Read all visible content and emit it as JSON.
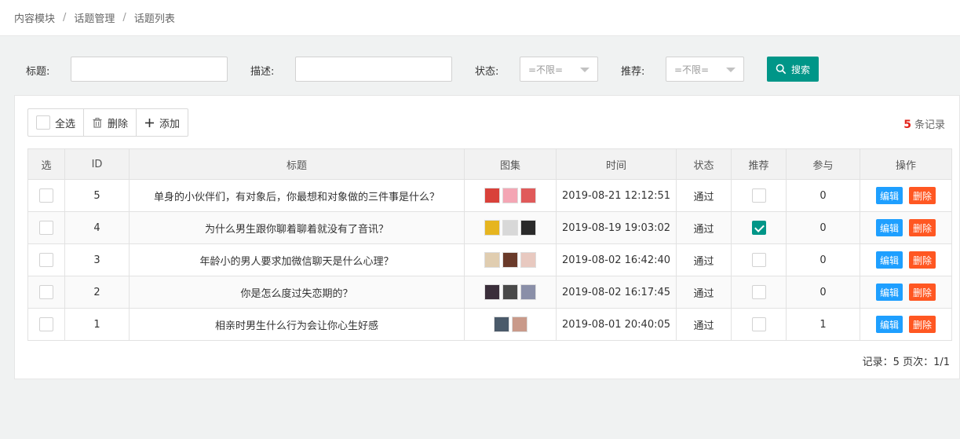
{
  "breadcrumb": {
    "items": [
      "内容模块",
      "话题管理",
      "话题列表"
    ]
  },
  "filter": {
    "title_label": "标题:",
    "title_value": "",
    "desc_label": "描述:",
    "desc_value": "",
    "status_label": "状态:",
    "status_value": "=不限=",
    "recommend_label": "推荐:",
    "recommend_value": "=不限=",
    "search_label": "搜索",
    "accent_color": "#009688"
  },
  "toolbar": {
    "select_all": "全选",
    "delete": "删除",
    "add": "添加"
  },
  "count": {
    "num": "5",
    "label": "条记录"
  },
  "table": {
    "headers": [
      "选",
      "ID",
      "标题",
      "图集",
      "时间",
      "状态",
      "推荐",
      "参与",
      "操作"
    ],
    "rows": [
      {
        "id": "5",
        "title": "单身的小伙伴们，有对象后，你最想和对象做的三件事是什么？",
        "time": "2019-08-21 12:12:51",
        "status": "通过",
        "recommended": false,
        "join": "0",
        "thumbs": [
          "#d9413a",
          "#f4a6b4",
          "#e05a5a"
        ]
      },
      {
        "id": "4",
        "title": "为什么男生跟你聊着聊着就没有了音讯？",
        "time": "2019-08-19 19:03:02",
        "status": "通过",
        "recommended": true,
        "join": "0",
        "thumbs": [
          "#e6b520",
          "#d8d8d8",
          "#2a2a2a"
        ]
      },
      {
        "id": "3",
        "title": "年龄小的男人要求加微信聊天是什么心理？",
        "time": "2019-08-02 16:42:40",
        "status": "通过",
        "recommended": false,
        "join": "0",
        "thumbs": [
          "#e0cdb0",
          "#6a3a2a",
          "#e8c9c0"
        ]
      },
      {
        "id": "2",
        "title": "你是怎么度过失恋期的？",
        "time": "2019-08-02 16:17:45",
        "status": "通过",
        "recommended": false,
        "join": "0",
        "thumbs": [
          "#3a2e3a",
          "#4a4a4a",
          "#8a8fa8"
        ]
      },
      {
        "id": "1",
        "title": "相亲时男生什么行为会让你心生好感",
        "time": "2019-08-01 20:40:05",
        "status": "通过",
        "recommended": false,
        "join": "1",
        "thumbs": [
          "#4a5a6a",
          "#c99a8a"
        ]
      }
    ],
    "edit_label": "编辑",
    "delete_label": "删除"
  },
  "pager": {
    "text": "记录：5  页次：1/1"
  }
}
